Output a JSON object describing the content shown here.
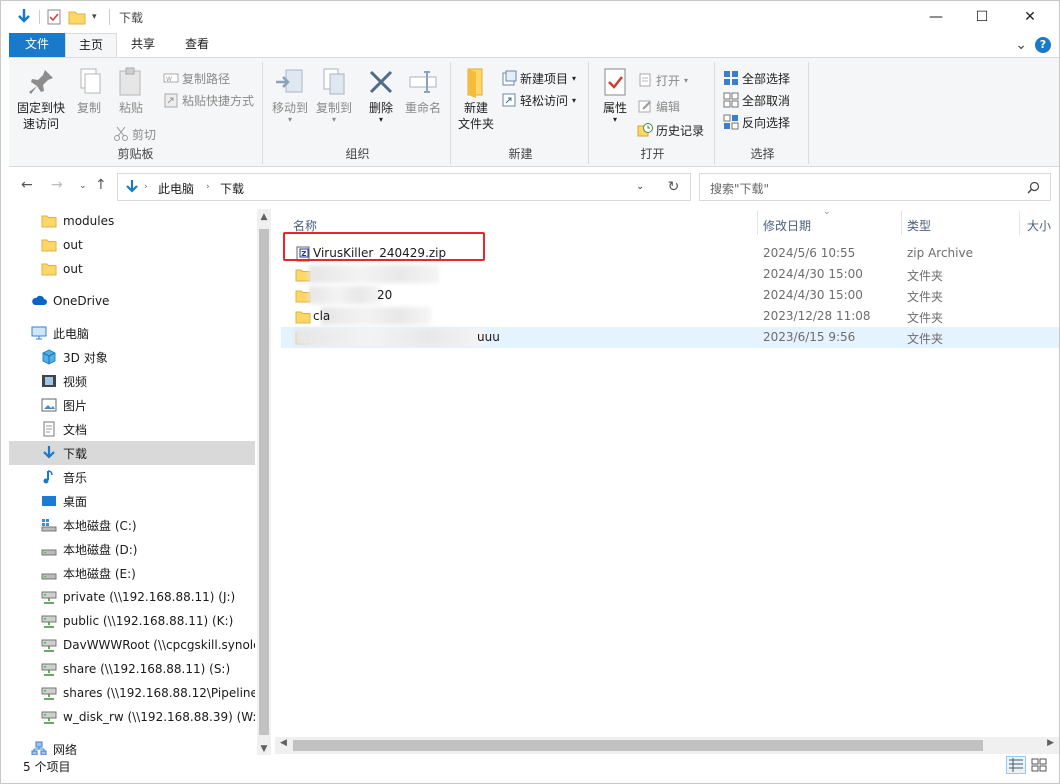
{
  "window": {
    "title": "下载",
    "controls": {
      "minimize": "—",
      "maximize": "☐",
      "close": "✕"
    }
  },
  "ribbon_tabs": [
    {
      "label": "文件"
    },
    {
      "label": "主页"
    },
    {
      "label": "共享"
    },
    {
      "label": "查看"
    }
  ],
  "ribbon_ctrl": {
    "collapse": "⌄",
    "help": "?"
  },
  "ribbon": {
    "clipboard": {
      "label": "剪贴板",
      "pin": "固定到快\n速访问",
      "copy": "复制",
      "paste": "粘贴",
      "copy_path": "复制路径",
      "paste_shortcut": "粘贴快捷方式",
      "cut": "剪切"
    },
    "organize": {
      "label": "组织",
      "move_to": "移动到",
      "copy_to": "复制到",
      "delete": "删除",
      "rename": "重命名"
    },
    "new": {
      "label": "新建",
      "new_folder": "新建\n文件夹",
      "new_item": "新建项目",
      "easy_access": "轻松访问"
    },
    "open": {
      "label": "打开",
      "properties": "属性",
      "open": "打开",
      "edit": "编辑",
      "history": "历史记录"
    },
    "select": {
      "label": "选择",
      "select_all": "全部选择",
      "select_none": "全部取消",
      "invert": "反向选择"
    }
  },
  "address": {
    "crumbs": [
      "此电脑",
      "下载"
    ],
    "search_placeholder": "搜索\"下载\""
  },
  "nav_pane": [
    {
      "label": "modules",
      "icon": "folder-icon",
      "indent": 2
    },
    {
      "label": "out",
      "icon": "folder-icon",
      "indent": 2
    },
    {
      "label": "out",
      "icon": "folder-icon",
      "indent": 2
    },
    {
      "label": "OneDrive",
      "icon": "cloud-icon",
      "indent": 1
    },
    {
      "label": "此电脑",
      "icon": "computer-icon",
      "indent": 1
    },
    {
      "label": "3D 对象",
      "icon": "cube-icon",
      "indent": 2
    },
    {
      "label": "视频",
      "icon": "video-icon",
      "indent": 2
    },
    {
      "label": "图片",
      "icon": "pictures-icon",
      "indent": 2
    },
    {
      "label": "文档",
      "icon": "document-icon",
      "indent": 2
    },
    {
      "label": "下载",
      "icon": "download-icon",
      "indent": 2,
      "selected": true
    },
    {
      "label": "音乐",
      "icon": "music-icon",
      "indent": 2
    },
    {
      "label": "桌面",
      "icon": "desktop-icon",
      "indent": 2
    },
    {
      "label": "本地磁盘 (C:)",
      "icon": "system-drive-icon",
      "indent": 2
    },
    {
      "label": "本地磁盘 (D:)",
      "icon": "drive-icon",
      "indent": 2
    },
    {
      "label": "本地磁盘 (E:)",
      "icon": "drive-icon",
      "indent": 2
    },
    {
      "label": "private (\\\\192.168.88.11) (J:)",
      "icon": "network-drive-icon",
      "indent": 2
    },
    {
      "label": "public (\\\\192.168.88.11) (K:)",
      "icon": "network-drive-icon",
      "indent": 2
    },
    {
      "label": "DavWWWRoot (\\\\cpcgskill.synolc",
      "icon": "network-drive-icon",
      "indent": 2
    },
    {
      "label": "share (\\\\192.168.88.11) (S:)",
      "icon": "network-drive-icon",
      "indent": 2
    },
    {
      "label": "shares (\\\\192.168.88.12\\PipelineS",
      "icon": "network-drive-icon",
      "indent": 2
    },
    {
      "label": "w_disk_rw (\\\\192.168.88.39) (W:)",
      "icon": "network-drive-icon",
      "indent": 2
    },
    {
      "label": "网络",
      "icon": "network-icon",
      "indent": 1
    }
  ],
  "columns": {
    "name": "名称",
    "modified": "修改日期",
    "type": "类型",
    "size": "大小"
  },
  "files": [
    {
      "name": "VirusKiller_240429.zip",
      "modified": "2024/5/6 10:55",
      "type": "zip Archive",
      "icon": "zip-file-icon"
    },
    {
      "name": "",
      "modified": "2024/4/30 15:00",
      "type": "文件夹",
      "icon": "folder-icon"
    },
    {
      "name": "20",
      "modified": "2024/4/30 15:00",
      "type": "文件夹",
      "icon": "folder-icon"
    },
    {
      "name": "cla",
      "modified": "2023/12/28 11:08",
      "type": "文件夹",
      "icon": "folder-icon"
    },
    {
      "name": "uuu",
      "modified": "2023/6/15 9:56",
      "type": "文件夹",
      "icon": "folder-icon",
      "selected": true
    }
  ],
  "status": {
    "count": "5 个项目"
  },
  "colors": {
    "accent": "#1979ca",
    "highlight_box": "#e8262a",
    "selected_row": "#e5f3ff",
    "nav_selected": "#d9d9d9"
  }
}
